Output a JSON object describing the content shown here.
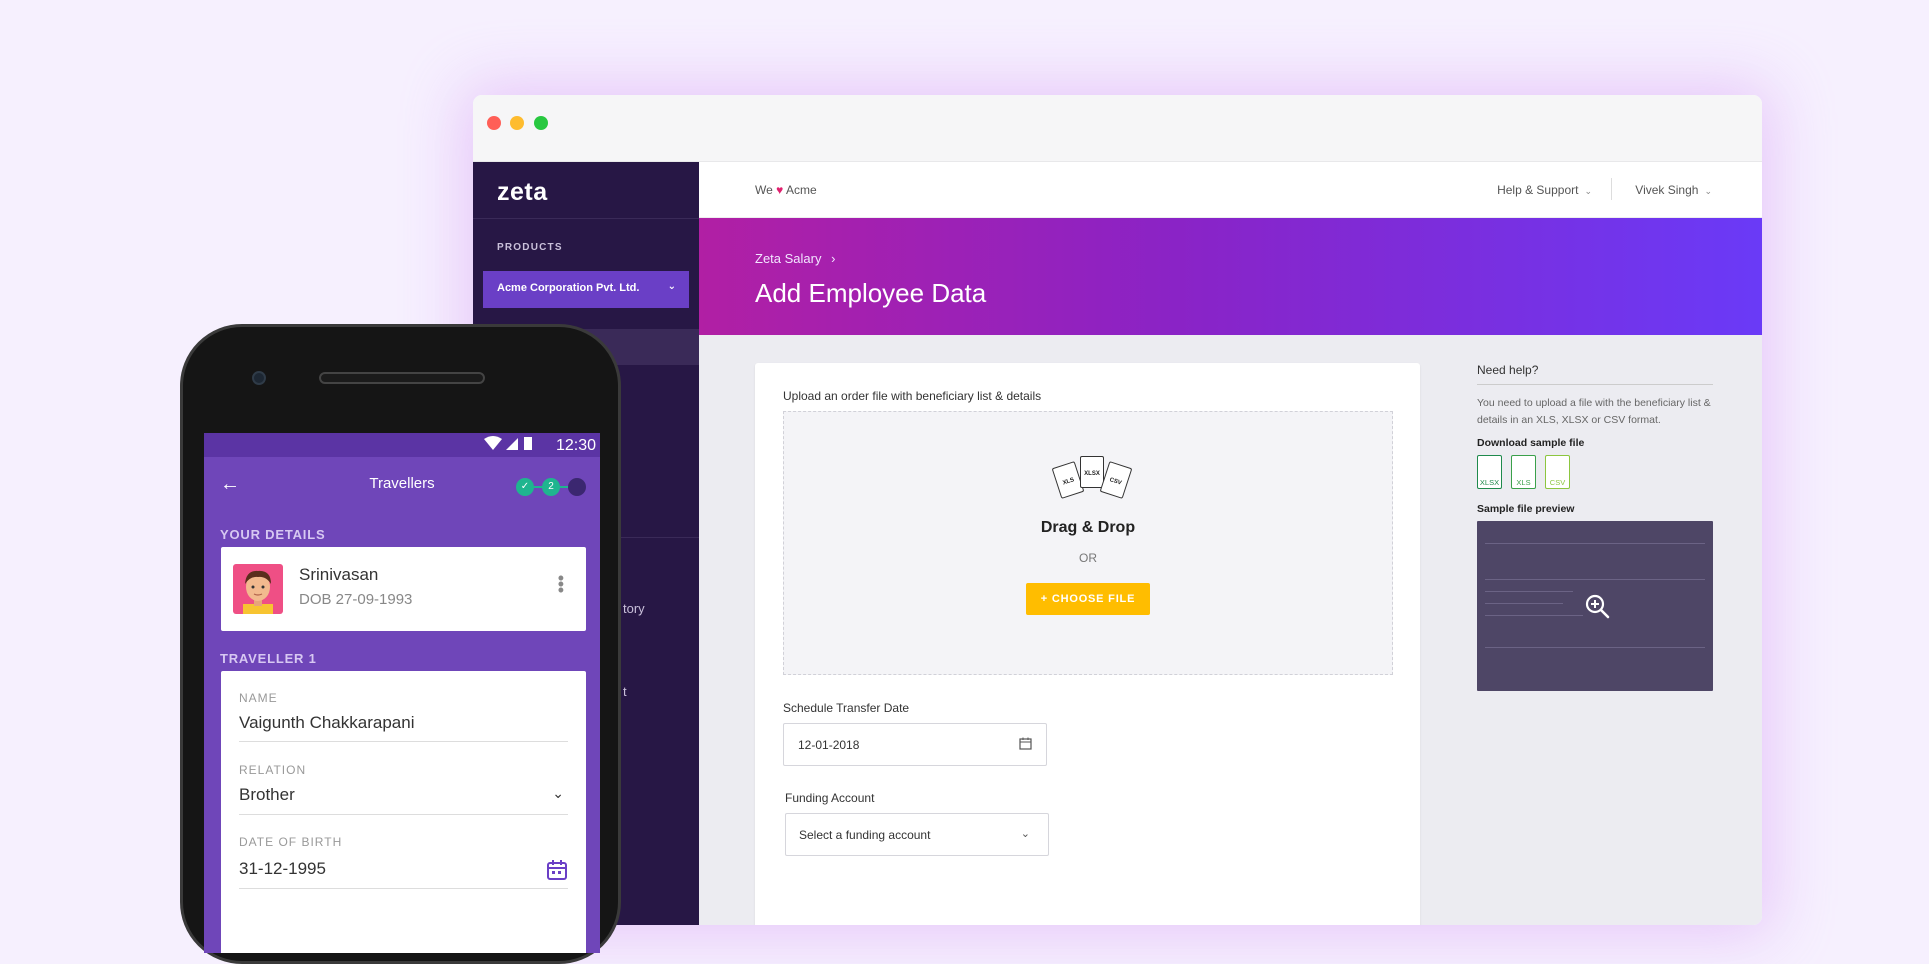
{
  "window": {
    "traffic_lights": [
      "red",
      "yellow",
      "green"
    ]
  },
  "sidebar": {
    "logo": "zeta",
    "section_label": "PRODUCTS",
    "company": "Acme Corporation Pvt. Ltd.",
    "partial_items": [
      "tory",
      "t"
    ]
  },
  "topbar": {
    "we": "We",
    "acme": "Acme",
    "help": "Help & Support",
    "user": "Vivek Singh"
  },
  "hero": {
    "breadcrumb": "Zeta Salary",
    "title": "Add Employee Data",
    "gradient": [
      "#b11fa4",
      "#6a3af7"
    ]
  },
  "form": {
    "upload_label": "Upload an order file with beneficiary list & details",
    "file_types": [
      "XLS",
      "XLSX",
      "CSV"
    ],
    "drag_drop": "Drag & Drop",
    "or": "OR",
    "choose_button": "+ CHOOSE FILE",
    "schedule_label": "Schedule Transfer Date",
    "schedule_value": "12-01-2018",
    "funding_label": "Funding Account",
    "funding_placeholder": "Select a funding account"
  },
  "help": {
    "title": "Need help?",
    "description": "You need to upload a file with the beneficiary list & details in an XLS, XLSX or CSV format.",
    "download_label": "Download sample file",
    "samples": [
      {
        "label": "XLSX",
        "color": "#1f8a4c"
      },
      {
        "label": "XLS",
        "color": "#3aa04a"
      },
      {
        "label": "CSV",
        "color": "#8cc63f"
      }
    ],
    "preview_label": "Sample file preview"
  },
  "phone": {
    "time": "12:30",
    "title": "Travellers",
    "steps": [
      "✓",
      "2",
      ""
    ],
    "your_details": "YOUR DETAILS",
    "person_name": "Srinivasan",
    "person_dob": "DOB 27-09-1993",
    "traveller": "TRAVELLER 1",
    "name_label": "NAME",
    "name_value": "Vaigunth Chakkarapani",
    "relation_label": "RELATION",
    "relation_value": "Brother",
    "dob_label": "DATE OF BIRTH",
    "dob_value": "31-12-1995"
  },
  "colors": {
    "accent": "#6a3fc6",
    "cta": "#ffbd00",
    "sidebar": "#271745",
    "heart": "#e0206e"
  }
}
